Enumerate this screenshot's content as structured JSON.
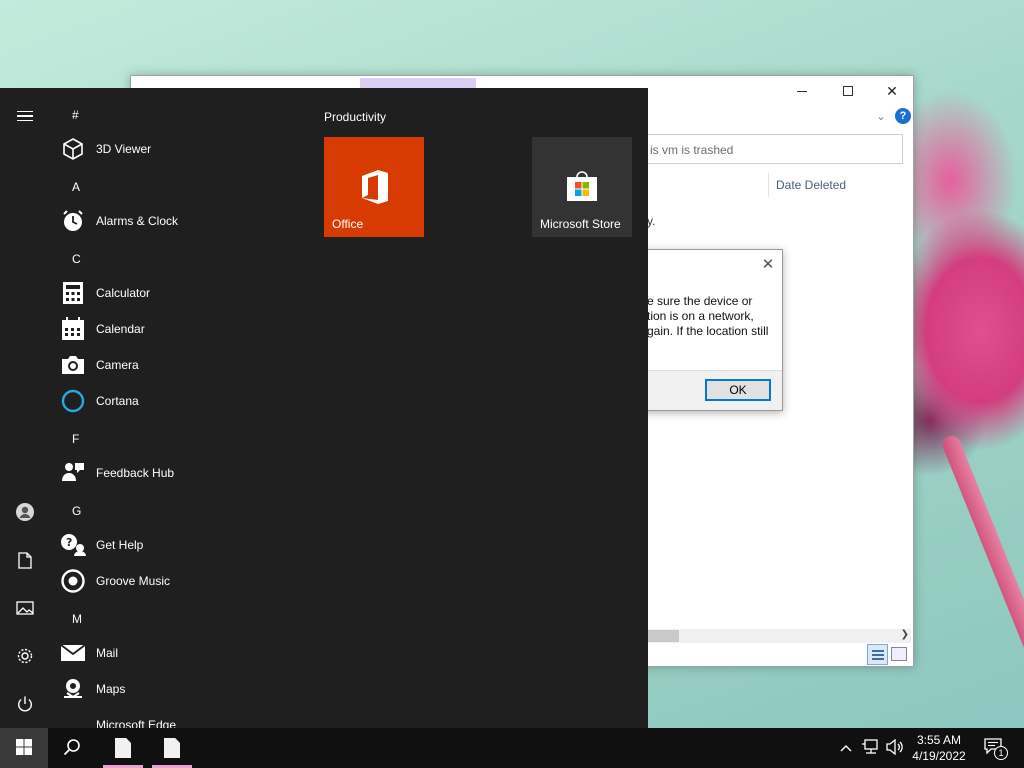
{
  "explorer": {
    "search_placeholder": "is vm is trashed",
    "column_date_deleted": "Date Deleted",
    "partial_text": "y.",
    "controls": {
      "minimize": "—",
      "maximize": "",
      "close": "✕"
    }
  },
  "dialog": {
    "close_label": "✕",
    "message": "e sure the device or\ntion is on a network,\ngain. If the location still",
    "ok_label": "OK"
  },
  "start_menu": {
    "groups": [
      {
        "header": "#",
        "items": [
          {
            "label": "3D Viewer",
            "icon": "cube-icon"
          }
        ]
      },
      {
        "header": "A",
        "items": [
          {
            "label": "Alarms & Clock",
            "icon": "alarm-clock-icon"
          }
        ]
      },
      {
        "header": "C",
        "items": [
          {
            "label": "Calculator",
            "icon": "calculator-icon"
          },
          {
            "label": "Calendar",
            "icon": "calendar-icon"
          },
          {
            "label": "Camera",
            "icon": "camera-icon"
          },
          {
            "label": "Cortana",
            "icon": "cortana-ring-icon"
          }
        ]
      },
      {
        "header": "F",
        "items": [
          {
            "label": "Feedback Hub",
            "icon": "feedback-icon"
          }
        ]
      },
      {
        "header": "G",
        "items": [
          {
            "label": "Get Help",
            "icon": "help-bubble-icon"
          },
          {
            "label": "Groove Music",
            "icon": "groove-music-icon"
          }
        ]
      },
      {
        "header": "M",
        "items": [
          {
            "label": "Mail",
            "icon": "mail-icon"
          },
          {
            "label": "Maps",
            "icon": "maps-icon"
          },
          {
            "label": "Microsoft Edge",
            "icon": "edge-icon"
          }
        ]
      }
    ],
    "tiles_header": "Productivity",
    "tiles": [
      {
        "label": "Office",
        "icon": "office-icon",
        "color": "#d83b01"
      },
      {
        "label": "Microsoft Store",
        "icon": "store-icon",
        "color": "#333333"
      }
    ],
    "rail": [
      "menu-icon",
      "user-icon",
      "documents-icon",
      "pictures-icon",
      "settings-icon",
      "power-icon"
    ]
  },
  "taskbar": {
    "time": "3:55 AM",
    "date": "4/19/2022",
    "notification_count": "1",
    "accent_underline": "#e8a3cf"
  }
}
